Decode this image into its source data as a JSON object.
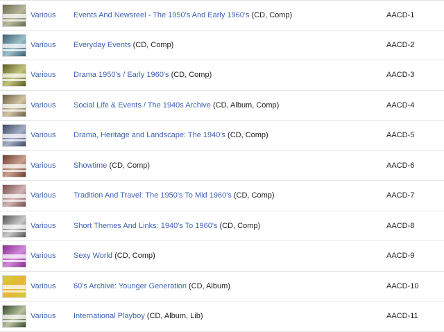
{
  "releases": [
    {
      "artist": "Various",
      "title": "Events And Newsreel - The 1950's And Early 1960's",
      "format": "(CD, Comp)",
      "catno": "AACD-1",
      "thumb_colors": [
        "#6b6b52",
        "#b7b79c"
      ]
    },
    {
      "artist": "Various",
      "title": "Everyday Events",
      "format": "(CD, Comp)",
      "catno": "AACD-2",
      "thumb_colors": [
        "#3a5f70",
        "#9cbfc8"
      ]
    },
    {
      "artist": "Various",
      "title": "Drama 1950's / Early 1960's",
      "format": "(CD, Comp)",
      "catno": "AACD-3",
      "thumb_colors": [
        "#5a5d20",
        "#c3c27a"
      ]
    },
    {
      "artist": "Various",
      "title": "Social Life & Events / The 1940s Archive",
      "format": "(CD, Album, Comp)",
      "catno": "AACD-4",
      "thumb_colors": [
        "#6b6046",
        "#d2c5a4"
      ]
    },
    {
      "artist": "Various",
      "title": "Drama, Heritage and Landscape: The 1940's",
      "format": "(CD, Comp)",
      "catno": "AACD-5",
      "thumb_colors": [
        "#3d4a66",
        "#a3adc5"
      ]
    },
    {
      "artist": "Various",
      "title": "Showtime",
      "format": "(CD, Comp)",
      "catno": "AACD-6",
      "thumb_colors": [
        "#6a3d2e",
        "#c9a08d"
      ]
    },
    {
      "artist": "Various",
      "title": "Tradition And Travel: The 1950's To Mid 1960's",
      "format": "(CD, Comp)",
      "catno": "AACD-7",
      "thumb_colors": [
        "#7a4d4d",
        "#cfb3b3"
      ]
    },
    {
      "artist": "Various",
      "title": "Short Themes And Links: 1940's To 1960's",
      "format": "(CD, Comp)",
      "catno": "AACD-8",
      "thumb_colors": [
        "#555555",
        "#c8c8c8"
      ]
    },
    {
      "artist": "Various",
      "title": "Sexy World",
      "format": "(CD, Comp)",
      "catno": "AACD-9",
      "thumb_colors": [
        "#8a2c93",
        "#d08ad7"
      ]
    },
    {
      "artist": "Various",
      "title": "60's Archive: Younger Generation",
      "format": "(CD, Album)",
      "catno": "AACD-10",
      "thumb_colors": [
        "#cfcf2e",
        "#e8b43a"
      ]
    },
    {
      "artist": "Various",
      "title": "International Playboy",
      "format": "(CD, Album, Lib)",
      "catno": "AACD-11",
      "thumb_colors": [
        "#3a4a2c",
        "#b6c2a0"
      ]
    }
  ]
}
